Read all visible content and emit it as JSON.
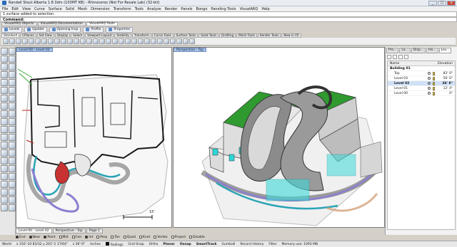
{
  "window": {
    "title": "Randall Stout Alberta 1.8.3dm (103MT KB) - Rhinoceros (Not For Resale Lab) (32-bit)",
    "min": "_",
    "max": "□",
    "close": "x"
  },
  "menu": [
    "File",
    "Edit",
    "View",
    "Curve",
    "Surface",
    "Solid",
    "Mesh",
    "Dimension",
    "Transform",
    "Tools",
    "Analyze",
    "Render",
    "Panels",
    "Bongo",
    "Paneling Tools",
    "VisualARQ",
    "Help"
  ],
  "command_history": "1 surface added to selection.",
  "command_prompt": "Command:",
  "plugin_tabs": [
    {
      "label": "VisualARQ Objects",
      "active": false
    },
    {
      "label": "VisualARQ Documentation",
      "active": false
    },
    {
      "label": "VisualARQ Tools",
      "active": true
    }
  ],
  "visualarq_buttons": [
    "Levels",
    "Update",
    "Opening Insp",
    "Profile",
    "Properties"
  ],
  "toolbar_tabs": [
    {
      "label": "Standard",
      "active": true
    },
    {
      "label": "CPlanes",
      "active": false
    },
    {
      "label": "Set View",
      "active": false
    },
    {
      "label": "Display",
      "active": false
    },
    {
      "label": "Select",
      "active": false
    },
    {
      "label": "Viewport Layout",
      "active": false
    },
    {
      "label": "Visibility",
      "active": false
    },
    {
      "label": "Transform",
      "active": false
    },
    {
      "label": "Curve Tools",
      "active": false
    },
    {
      "label": "Surface Tools",
      "active": false
    },
    {
      "label": "Solid Tools",
      "active": false
    },
    {
      "label": "Drafting",
      "active": false
    },
    {
      "label": "Mesh Tools",
      "active": false
    },
    {
      "label": "Render Tools",
      "active": false
    },
    {
      "label": "New in V5",
      "active": false
    }
  ],
  "viewports": {
    "left_title": "Level 00 - Level 02",
    "right_title": "Perspective - Top",
    "scale_label": "15'"
  },
  "panel": {
    "tabs": [
      {
        "label": "Pro...",
        "active": false
      },
      {
        "label": "La...",
        "active": false
      },
      {
        "label": "Disp...",
        "active": false
      },
      {
        "label": "He...",
        "active": false
      },
      {
        "label": "Lev...",
        "active": true
      }
    ],
    "header_name": "Name",
    "header_elev": "Elevation",
    "levels": [
      {
        "name": "Building 01",
        "elev": "",
        "bold": true,
        "selected": false,
        "indent": 0
      },
      {
        "name": "Top",
        "elev": "83' 0\"",
        "bold": false,
        "selected": false,
        "indent": 1
      },
      {
        "name": "Level 03",
        "elev": "56' 0\"",
        "bold": false,
        "selected": false,
        "indent": 1
      },
      {
        "name": "Level 02",
        "elev": "36' 8\"",
        "bold": true,
        "selected": true,
        "indent": 1
      },
      {
        "name": "Level 01",
        "elev": "12' 4\"",
        "bold": false,
        "selected": false,
        "indent": 1
      },
      {
        "name": "Level 00",
        "elev": "0\"",
        "bold": false,
        "selected": false,
        "indent": 1
      }
    ]
  },
  "bottom_tabs": [
    {
      "label": "Level 00 - Level 02",
      "active": true
    },
    {
      "label": "Perspective - Top",
      "active": false
    },
    {
      "label": "Page 1",
      "active": false
    }
  ],
  "osnaps": [
    {
      "label": "End",
      "on": true
    },
    {
      "label": "Near",
      "on": true
    },
    {
      "label": "Point",
      "on": true
    },
    {
      "label": "Mid",
      "on": false
    },
    {
      "label": "Cen",
      "on": false
    },
    {
      "label": "Int",
      "on": true
    },
    {
      "label": "Perp",
      "on": false
    },
    {
      "label": "Tan",
      "on": false
    },
    {
      "label": "Quad",
      "on": false
    },
    {
      "label": "Knot",
      "on": false
    },
    {
      "label": "Vertex",
      "on": false
    },
    {
      "label": "Project",
      "on": false
    },
    {
      "label": "Disable",
      "on": false
    }
  ],
  "status": {
    "cplane": "World",
    "coords": "x 150'-10 83/32  y 201'-1 17/64\"",
    "z": "z 36'-0\"",
    "units": "Inches",
    "layer": "Railings",
    "toggles": [
      {
        "label": "Grid Snap",
        "on": false
      },
      {
        "label": "Ortho",
        "on": false
      },
      {
        "label": "Planar",
        "on": true
      },
      {
        "label": "Osnap",
        "on": true
      },
      {
        "label": "SmartTrack",
        "on": true
      },
      {
        "label": "Gumball",
        "on": false
      },
      {
        "label": "Record History",
        "on": false
      },
      {
        "label": "Filter",
        "on": false
      }
    ],
    "memory": "Memory use: 1093 MB"
  }
}
